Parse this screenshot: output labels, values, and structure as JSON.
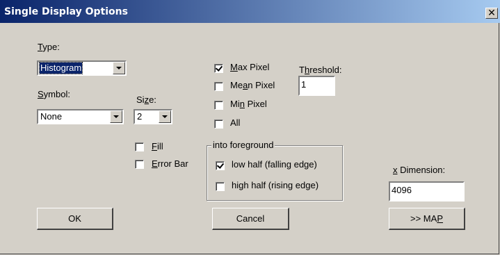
{
  "window": {
    "title": "Single Display Options",
    "close_label": "✕"
  },
  "type": {
    "label_hotkey": "T",
    "label_rest": "ype:",
    "value": "Histogram"
  },
  "symbol": {
    "label_hotkey": "S",
    "label_rest": "ymbol:",
    "value": "None"
  },
  "size": {
    "label_pre": "Si",
    "label_hotkey": "z",
    "label_rest": "e:",
    "value": "2"
  },
  "fill": {
    "label_hotkey": "F",
    "label_rest": "ill",
    "checked": false
  },
  "error_bar": {
    "label_hotkey": "E",
    "label_rest": "rror Bar",
    "checked": false
  },
  "max_pixel": {
    "label_hotkey": "M",
    "label_rest": "ax Pixel",
    "checked": true
  },
  "mean_pixel": {
    "label_pre": "Me",
    "label_hotkey": "a",
    "label_rest": "n Pixel",
    "checked": false
  },
  "min_pixel": {
    "label_pre": "Mi",
    "label_hotkey": "n",
    "label_rest": " Pixel",
    "checked": false
  },
  "all": {
    "label": "All",
    "checked": false
  },
  "threshold": {
    "label_pre": "T",
    "label_hotkey": "h",
    "label_rest": "reshold:",
    "value": "1"
  },
  "foreground": {
    "legend": "into foreground",
    "low_half": {
      "label": "low half (falling edge)",
      "checked": true
    },
    "high_half": {
      "label": "high half (rising edge)",
      "checked": false
    }
  },
  "x_dimension": {
    "label_hotkey": "x",
    "label_rest": " Dimension:",
    "value": "4096"
  },
  "buttons": {
    "ok": "OK",
    "cancel": "Cancel",
    "map_pre": ">> MA",
    "map_hotkey": "P"
  }
}
